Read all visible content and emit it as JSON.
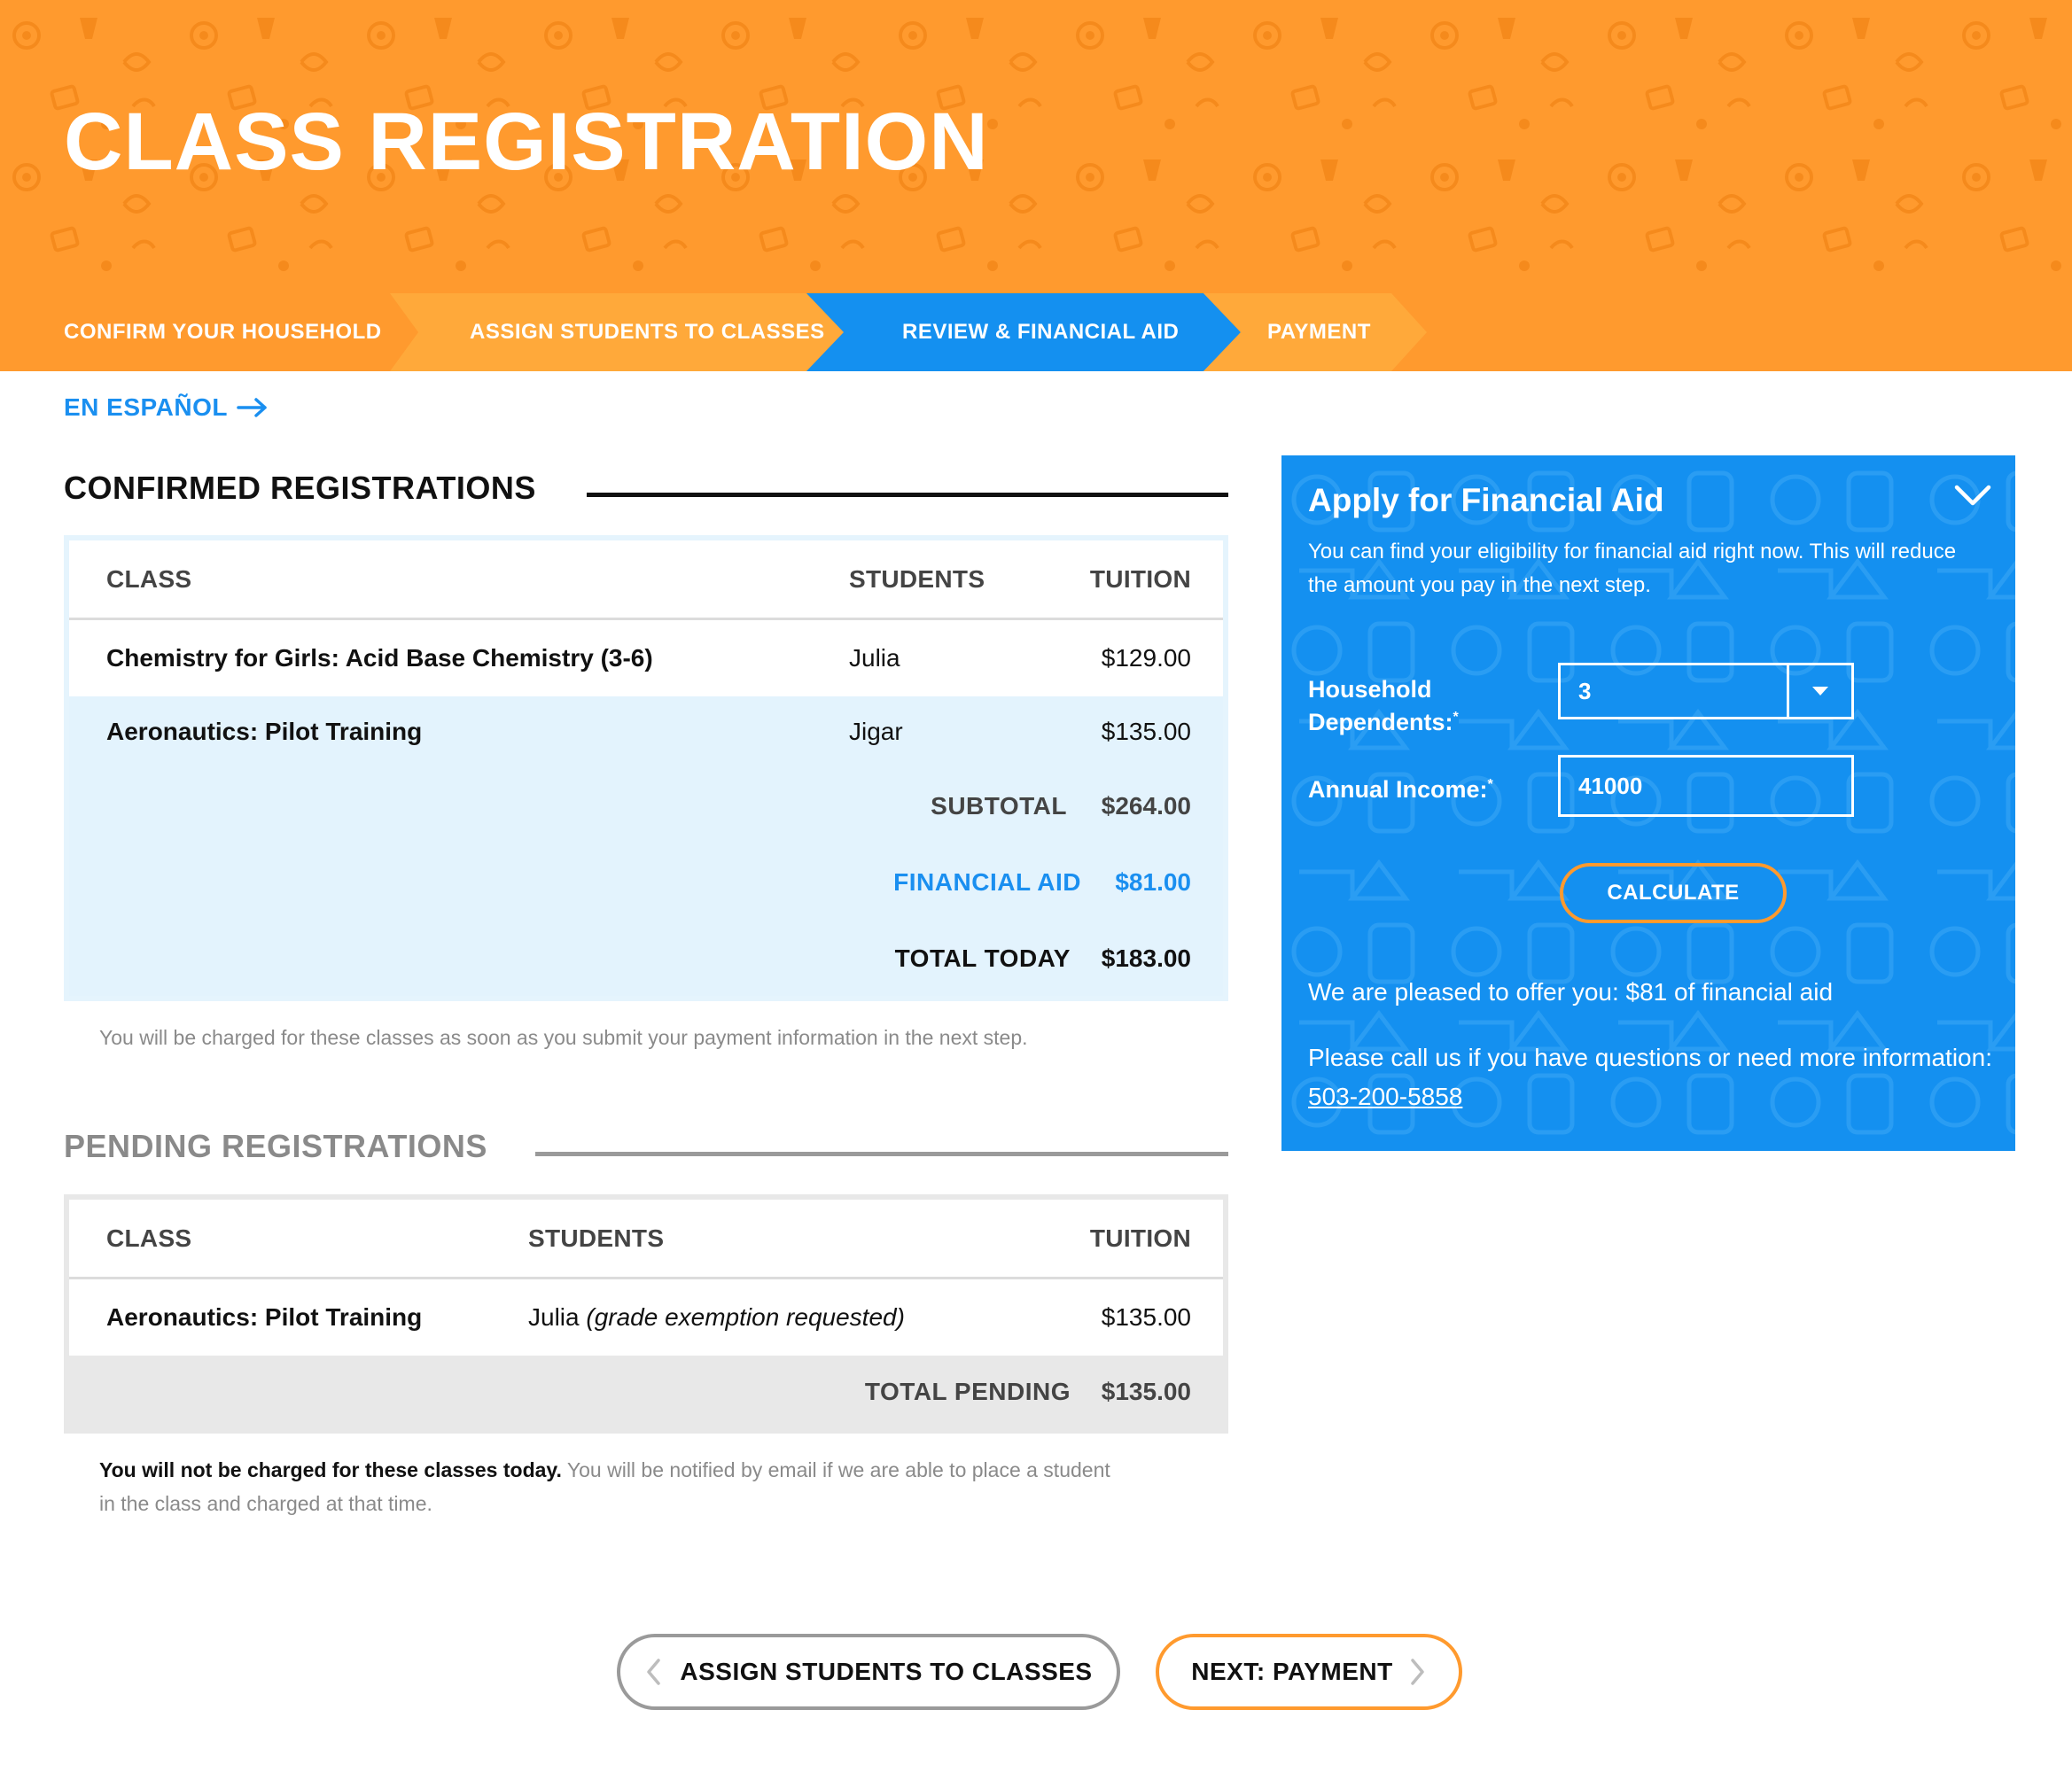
{
  "header": {
    "title": "CLASS REGISTRATION",
    "brand_color": "#ff9a2e",
    "active_color": "#1490f0",
    "steps": [
      {
        "label": "CONFIRM YOUR HOUSEHOLD",
        "state": "completed"
      },
      {
        "label": "ASSIGN STUDENTS TO CLASSES",
        "state": "completed"
      },
      {
        "label": "REVIEW & FINANCIAL AID",
        "state": "active"
      },
      {
        "label": "PAYMENT",
        "state": "upcoming"
      }
    ]
  },
  "language_link": {
    "label": "EN ESPAÑOL",
    "icon": "arrow-right-icon"
  },
  "confirmed": {
    "title": "CONFIRMED REGISTRATIONS",
    "columns": {
      "class": "CLASS",
      "students": "STUDENTS",
      "tuition": "TUITION"
    },
    "rows": [
      {
        "class": "Chemistry for Girls: Acid Base Chemistry (3-6)",
        "student": "Julia",
        "tuition": "$129.00"
      },
      {
        "class": "Aeronautics: Pilot Training",
        "student": "Jigar",
        "tuition": "$135.00"
      }
    ],
    "subtotal_label": "SUBTOTAL",
    "subtotal": "$264.00",
    "aid_label": "FINANCIAL AID",
    "aid": "$81.00",
    "total_label": "TOTAL TODAY",
    "total": "$183.00",
    "note": "You will be charged for these classes as soon as you submit your payment information in the next step."
  },
  "pending": {
    "title": "PENDING REGISTRATIONS",
    "columns": {
      "class": "CLASS",
      "students": "STUDENTS",
      "tuition": "TUITION"
    },
    "rows": [
      {
        "class": "Aeronautics: Pilot Training",
        "student": "Julia",
        "student_note": "(grade exemption requested)",
        "tuition": "$135.00"
      }
    ],
    "total_label": "TOTAL PENDING",
    "total": "$135.00",
    "note_bold": "You will not be charged for these classes today.",
    "note_line1": "You will be notified by email if we are able to place a student",
    "note_line2": "in the class and charged at that time."
  },
  "financial_aid": {
    "title": "Apply for Financial Aid",
    "description": "You can find your eligibility for financial aid right now. This will reduce the amount you pay in the next step.",
    "dependents_label_1": "Household",
    "dependents_label_2": "Dependents:",
    "dependents_value": "3",
    "income_label": "Annual Income:",
    "income_value": "41000",
    "required_mark": "*",
    "calculate_label": "CALCULATE",
    "offer_text": "We are pleased to offer you: $81 of financial aid",
    "contact_text": "Please call us if you have questions or need more information:",
    "phone": "503-200-5858"
  },
  "footer_nav": {
    "back_label": "ASSIGN STUDENTS TO CLASSES",
    "next_label": "NEXT: PAYMENT"
  }
}
